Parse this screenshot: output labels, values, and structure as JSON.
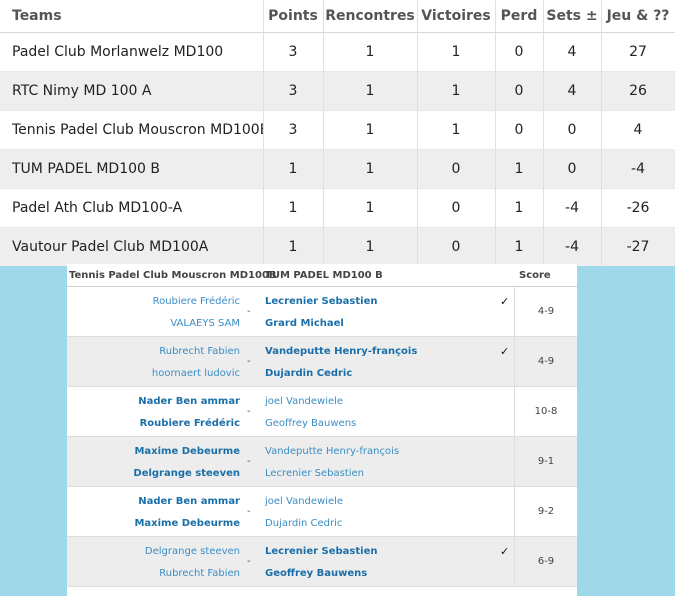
{
  "standings": {
    "headers": [
      "Teams",
      "Points",
      "Rencontres",
      "Victoires",
      "Perd",
      "Sets ±",
      "Jeu & ??"
    ],
    "rows": [
      [
        "Padel Club Morlanwelz MD100",
        "3",
        "1",
        "1",
        "0",
        "4",
        "27"
      ],
      [
        "RTC Nimy MD 100 A",
        "3",
        "1",
        "1",
        "0",
        "4",
        "26"
      ],
      [
        "Tennis Padel Club Mouscron MD100B",
        "3",
        "1",
        "1",
        "0",
        "0",
        "4"
      ],
      [
        "TUM PADEL MD100 B",
        "1",
        "1",
        "0",
        "1",
        "0",
        "-4"
      ],
      [
        "Padel Ath Club MD100-A",
        "1",
        "1",
        "0",
        "1",
        "-4",
        "-26"
      ],
      [
        "Vautour Padel Club MD100A",
        "1",
        "1",
        "0",
        "1",
        "-4",
        "-27"
      ]
    ]
  },
  "matches": {
    "home_team": "Tennis Padel Club Mouscron MD100B",
    "away_team": "TUM PADEL MD100 B",
    "score_label": "Score",
    "separator": "-",
    "check_mark": "✓",
    "list": [
      {
        "home": [
          "Roubiere Frédéric",
          "VALAEYS SAM"
        ],
        "away": [
          "Lecrenier Sebastien",
          "Grard Michael"
        ],
        "score": "4-9",
        "winner": "away"
      },
      {
        "home": [
          "Rubrecht Fabien",
          "hoornaert ludovic"
        ],
        "away": [
          "Vandeputte Henry-françois",
          "Dujardin Cedric"
        ],
        "score": "4-9",
        "winner": "away"
      },
      {
        "home": [
          "Nader Ben ammar",
          "Roubiere Frédéric"
        ],
        "away": [
          "joel Vandewiele",
          "Geoffrey Bauwens"
        ],
        "score": "10-8",
        "winner": "home"
      },
      {
        "home": [
          "Maxime Debeurme",
          "Delgrange steeven"
        ],
        "away": [
          "Vandeputte Henry-françois",
          "Lecrenier Sebastien"
        ],
        "score": "9-1",
        "winner": "home"
      },
      {
        "home": [
          "Nader Ben ammar",
          "Maxime Debeurme"
        ],
        "away": [
          "joel Vandewiele",
          "Dujardin Cedric"
        ],
        "score": "9-2",
        "winner": "home"
      },
      {
        "home": [
          "Delgrange steeven",
          "Rubrecht Fabien"
        ],
        "away": [
          "Lecrenier Sebastien",
          "Geoffrey Bauwens"
        ],
        "score": "6-9",
        "winner": "away"
      }
    ]
  },
  "colors": {
    "background": "#9fd8e8",
    "link": "#3a8ec4",
    "link_bold": "#1a6fa8"
  }
}
